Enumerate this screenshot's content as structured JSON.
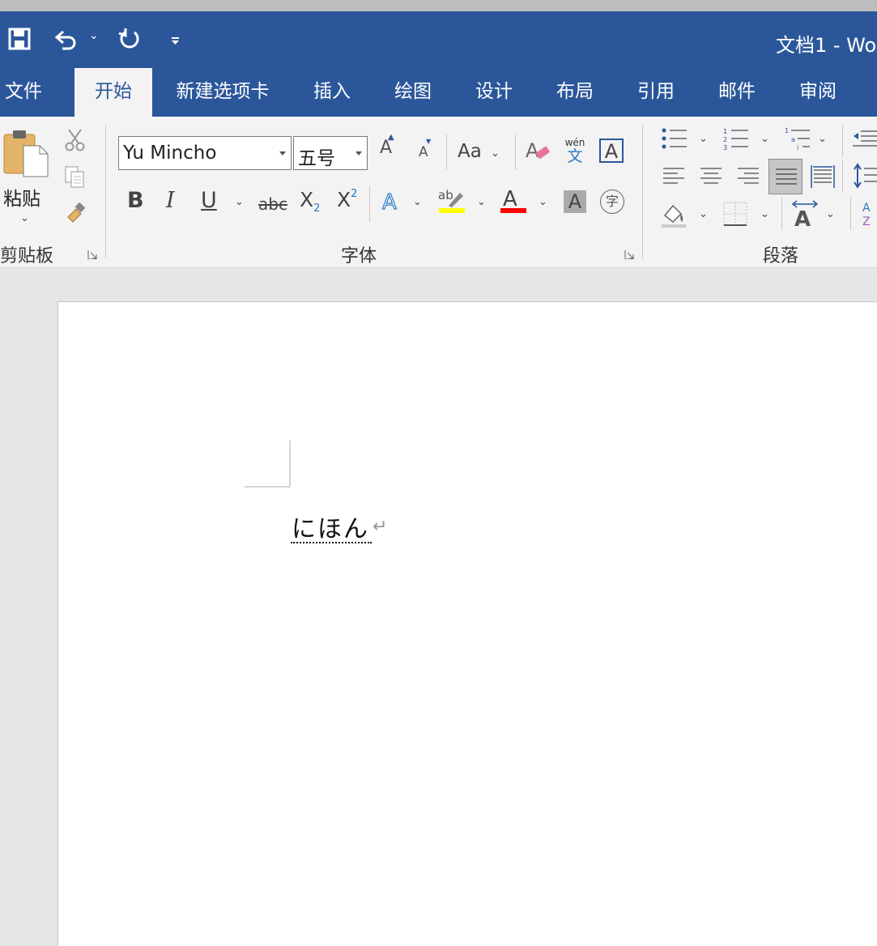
{
  "title_bar": {
    "document_title": "文档1  -  Wo",
    "quick_access": [
      "save-icon",
      "undo-icon",
      "redo-icon",
      "customize-icon"
    ],
    "background": "#2b579a"
  },
  "tabs": [
    {
      "label": "文件",
      "active": false
    },
    {
      "label": "开始",
      "active": true
    },
    {
      "label": "新建选项卡",
      "active": false
    },
    {
      "label": "插入",
      "active": false
    },
    {
      "label": "绘图",
      "active": false
    },
    {
      "label": "设计",
      "active": false
    },
    {
      "label": "布局",
      "active": false
    },
    {
      "label": "引用",
      "active": false
    },
    {
      "label": "邮件",
      "active": false
    },
    {
      "label": "审阅",
      "active": false
    }
  ],
  "clipboard": {
    "group_label": "剪贴板",
    "paste_label": "粘贴"
  },
  "font": {
    "group_label": "字体",
    "font_name": "Yu Mincho",
    "font_size": "五号",
    "change_case": "Aa",
    "phonetic_top": "wén",
    "phonetic_bottom": "文",
    "bold": "B",
    "italic": "I",
    "underline": "U",
    "strikethrough": "abc",
    "subscript": "X",
    "subscript_mark": "2",
    "superscript": "X",
    "superscript_mark": "2",
    "enclose": "字",
    "highlight_color": "#ffff00",
    "font_color": "#ff0000"
  },
  "paragraph": {
    "group_label": "段落"
  },
  "document": {
    "text": "にほん",
    "paragraph_mark": "↵"
  }
}
